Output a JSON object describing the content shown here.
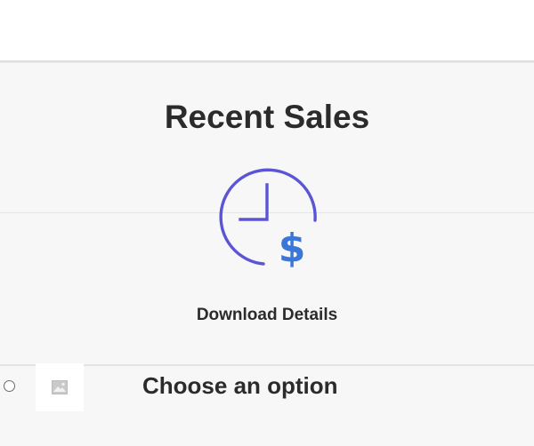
{
  "section": {
    "title": "Recent Sales",
    "icon": "clock-dollar-icon",
    "download_label": "Download Details"
  },
  "option": {
    "label": "Choose an option",
    "thumbnail_icon": "image-placeholder-icon",
    "selected": false
  },
  "colors": {
    "clock_stroke": "#5b55d6",
    "dollar": "#3a77d8",
    "panel_bg": "#f7f7f7",
    "text": "#2b2b2b"
  }
}
